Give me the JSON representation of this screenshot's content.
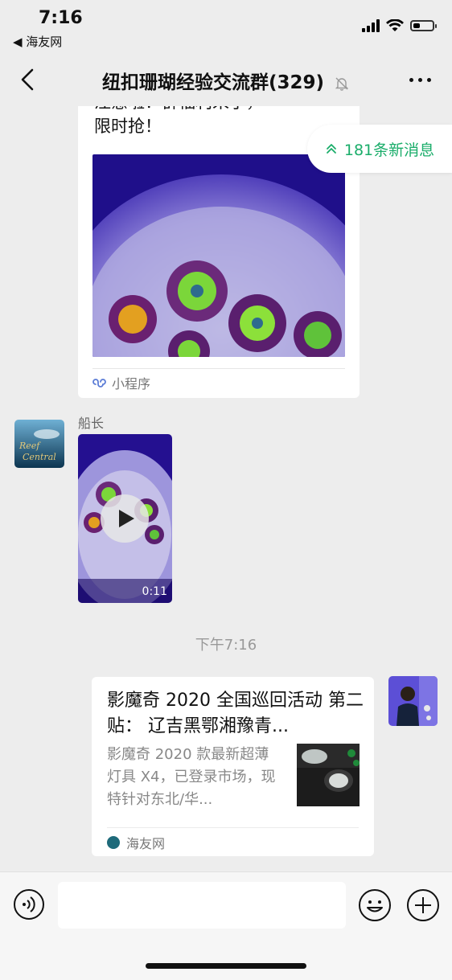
{
  "status_bar": {
    "time": "7:16",
    "back_app": "◀ 海友网",
    "battery_level": 0.35
  },
  "nav": {
    "title": "纽扣珊瑚经验交流群(329)",
    "muted": true
  },
  "new_messages": {
    "label": "181条新消息",
    "accent": "#1aad6a"
  },
  "card1": {
    "text_line1": "注意啦！群福利来了，",
    "text_line2": "限时抢！",
    "footer": "小程序"
  },
  "video_message": {
    "sender": "船长",
    "duration": "0:11"
  },
  "timestamp": "下午7:16",
  "card2": {
    "title": "影魔奇 2020 全国巡回活动 第二贴： 辽吉黑鄂湘豫青...",
    "description": "影魔奇 2020 款最新超薄灯具 X4，已登录市场，现特针对东北/华...",
    "source": "海友网"
  },
  "input_bar": {
    "placeholder": ""
  },
  "icons": {
    "voice": "voice-icon",
    "emoji": "emoji-icon",
    "plus": "plus-icon",
    "miniprogram": "miniprogram-icon",
    "mute": "mute-bell-icon"
  }
}
